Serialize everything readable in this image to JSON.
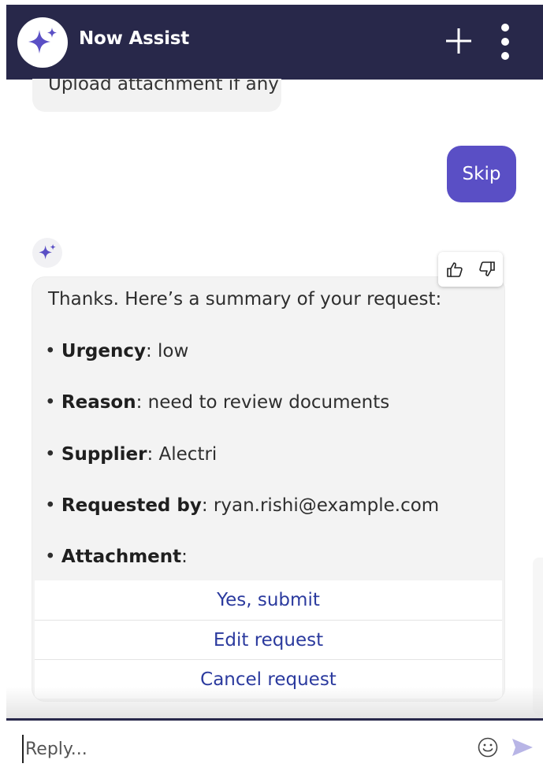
{
  "header": {
    "title": "Now Assist",
    "brand_color": "#28284a",
    "icons": [
      "sparkle-icon",
      "plus-icon",
      "kebab-menu-icon"
    ]
  },
  "conversation": {
    "previous_prompt": "Upload attachment if any",
    "user_reply": "Skip",
    "user_bubble_color": "#5a4fc5",
    "summary": {
      "intro": "Thanks. Here’s a summary of your request:",
      "items": [
        {
          "label": "Urgency",
          "value": ": low"
        },
        {
          "label": "Reason",
          "value": ": need to review documents"
        },
        {
          "label": "Supplier",
          "value": ": Alectri"
        },
        {
          "label": "Requested by",
          "value": ": ryan.rishi@example.com"
        },
        {
          "label": "Attachment",
          "value": ":"
        }
      ],
      "bullet": "•"
    },
    "actions": [
      {
        "label": "Yes, submit"
      },
      {
        "label": "Edit request"
      },
      {
        "label": "Cancel request"
      }
    ],
    "feedback_icons": [
      "thumbs-up-icon",
      "thumbs-down-icon"
    ]
  },
  "composer": {
    "placeholder": "Reply...",
    "icons": [
      "emoji-icon",
      "send-icon"
    ]
  }
}
